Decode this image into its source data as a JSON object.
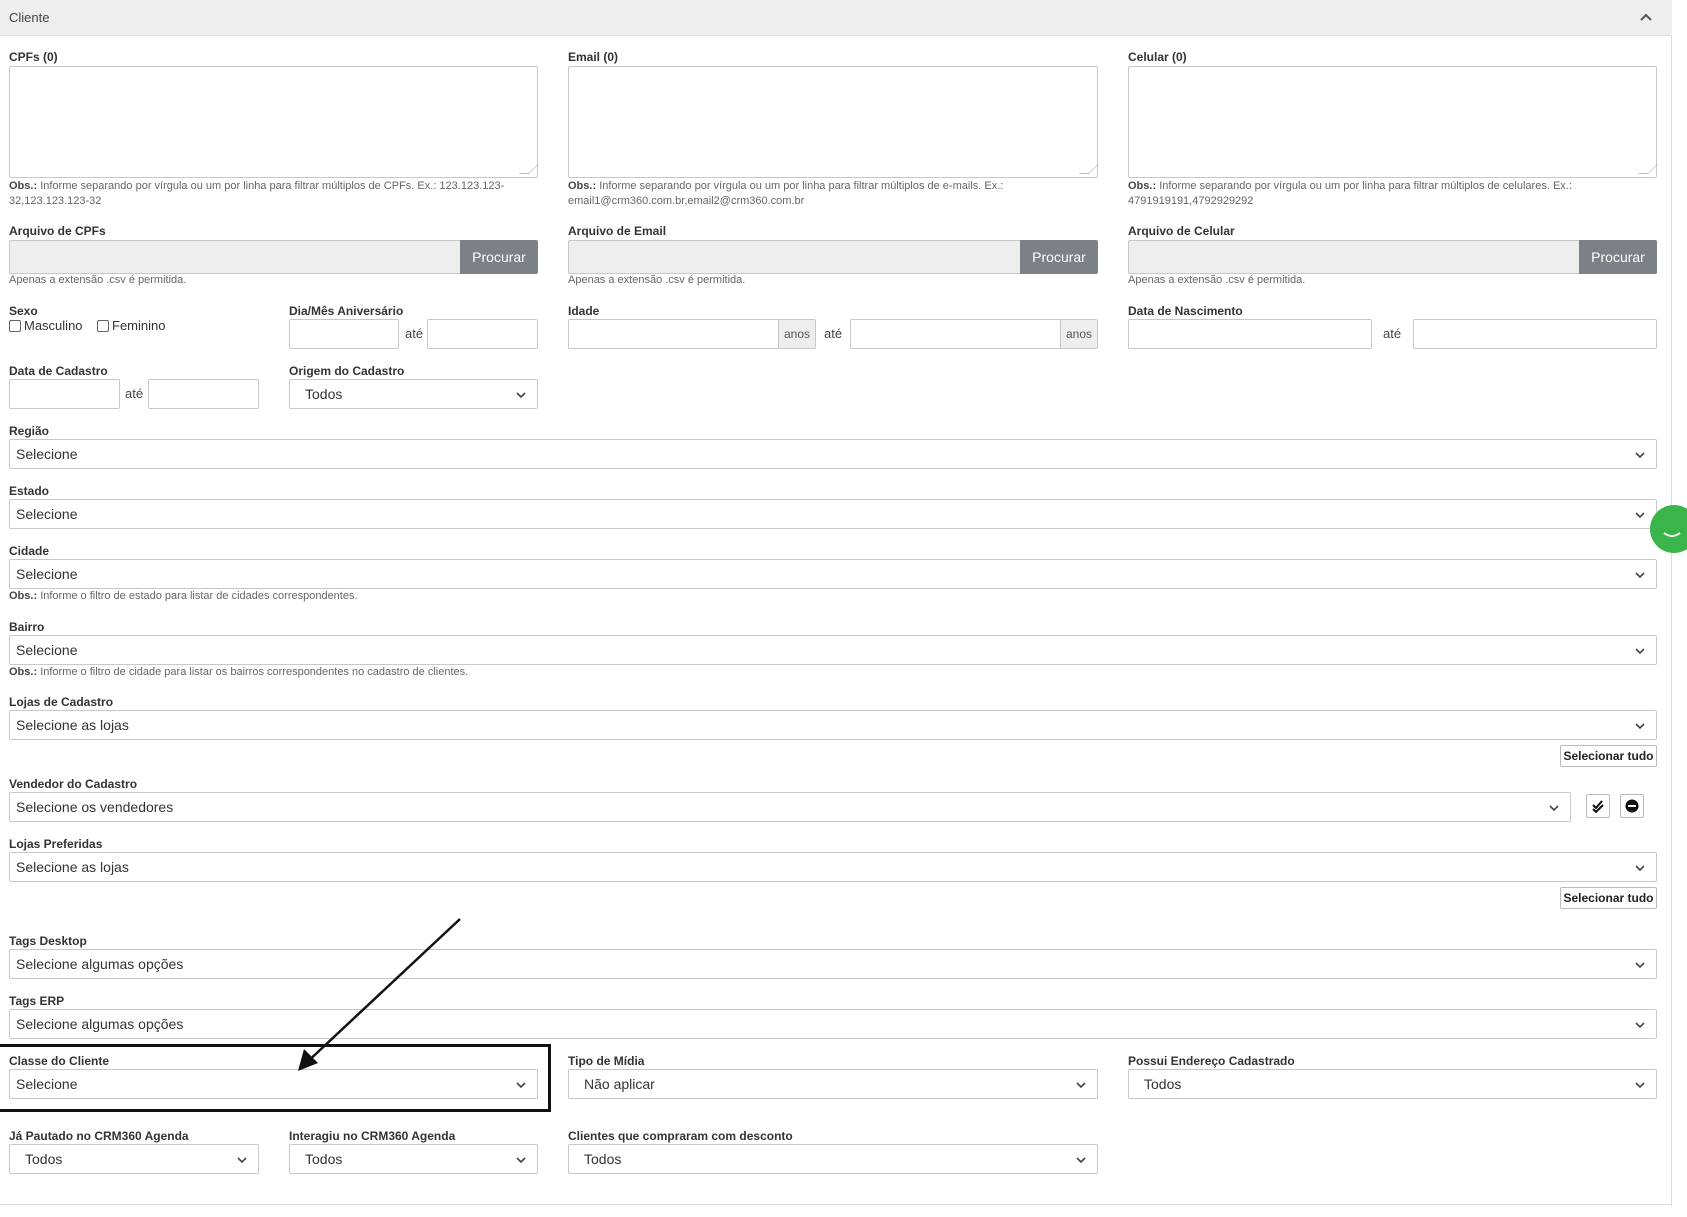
{
  "panel": {
    "title": "Cliente"
  },
  "cpfs": {
    "label": "CPFs (0)",
    "obs_prefix": "Obs.:",
    "obs_text": "Informe separando por vírgula ou um por linha para filtrar múltiplos de CPFs. Ex.: 123.123.123-32,123.123.123-32"
  },
  "email": {
    "label": "Email (0)",
    "obs_prefix": "Obs.:",
    "obs_text": "Informe separando por vírgula ou um por linha para filtrar múltiplos de e-mails. Ex.: email1@crm360.com.br,email2@crm360.com.br"
  },
  "celular": {
    "label": "Celular (0)",
    "obs_prefix": "Obs.:",
    "obs_text": "Informe separando por vírgula ou um por linha para filtrar múltiplos de celulares. Ex.: 4791919191,4792929292"
  },
  "files": {
    "cpf_label": "Arquivo de CPFs",
    "email_label": "Arquivo de Email",
    "celular_label": "Arquivo de Celular",
    "browse": "Procurar",
    "hint": "Apenas a extensão .csv é permitida."
  },
  "sexo": {
    "label": "Sexo",
    "masculino": "Masculino",
    "feminino": "Feminino"
  },
  "aniversario": {
    "label": "Dia/Mês Aniversário",
    "ate": "até"
  },
  "idade": {
    "label": "Idade",
    "unit": "anos",
    "ate": "até"
  },
  "nascimento": {
    "label": "Data de Nascimento",
    "ate": "até"
  },
  "cadastro": {
    "label": "Data de Cadastro",
    "ate": "até"
  },
  "origem": {
    "label": "Origem do Cadastro",
    "value": "Todos"
  },
  "regiao": {
    "label": "Região",
    "value": "Selecione"
  },
  "estado": {
    "label": "Estado",
    "value": "Selecione"
  },
  "cidade": {
    "label": "Cidade",
    "value": "Selecione",
    "obs_prefix": "Obs.:",
    "obs_text": "Informe o filtro de estado para listar de cidades correspondentes."
  },
  "bairro": {
    "label": "Bairro",
    "value": "Selecione",
    "obs_prefix": "Obs.:",
    "obs_text": "Informe o filtro de cidade para listar os bairros correspondentes no cadastro de clientes."
  },
  "lojas_cadastro": {
    "label": "Lojas de Cadastro",
    "value": "Selecione as lojas",
    "select_all": "Selecionar tudo"
  },
  "vendedor": {
    "label": "Vendedor do Cadastro",
    "value": "Selecione os vendedores"
  },
  "lojas_preferidas": {
    "label": "Lojas Preferidas",
    "value": "Selecione as lojas",
    "select_all": "Selecionar tudo"
  },
  "tags_desktop": {
    "label": "Tags Desktop",
    "value": "Selecione algumas opções"
  },
  "tags_erp": {
    "label": "Tags ERP",
    "value": "Selecione algumas opções"
  },
  "classe": {
    "label": "Classe do Cliente",
    "value": "Selecione"
  },
  "midia": {
    "label": "Tipo de Mídia",
    "value": "Não aplicar"
  },
  "endereco": {
    "label": "Possui Endereço Cadastrado",
    "value": "Todos"
  },
  "pautado": {
    "label": "Já Pautado no CRM360 Agenda",
    "value": "Todos"
  },
  "interagiu": {
    "label": "Interagiu no CRM360 Agenda",
    "value": "Todos"
  },
  "desconto": {
    "label": "Clientes que compraram com desconto",
    "value": "Todos"
  },
  "icons": [
    "chevron-up-icon",
    "chevron-down-icon",
    "check-all-icon",
    "minus-circle-icon",
    "chat-bubble-icon",
    "arrow-annotation"
  ]
}
